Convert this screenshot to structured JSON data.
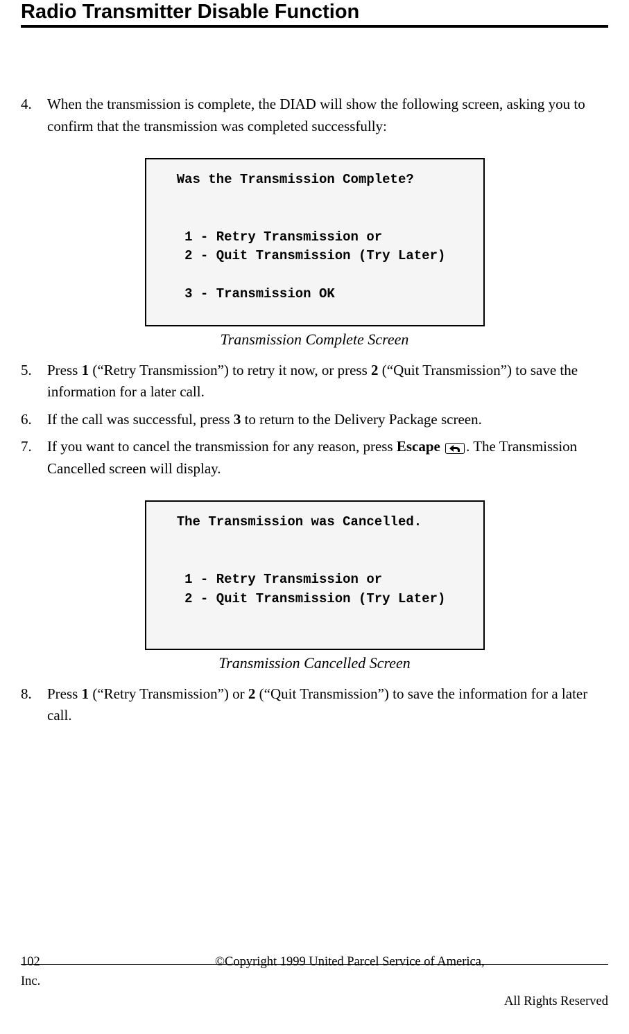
{
  "header": {
    "title": "Radio Transmitter Disable Function"
  },
  "steps": {
    "s4": {
      "num": "4.",
      "text_a": "When the transmission is complete, the DIAD will show the following screen, asking you to confirm that the transmission was completed successfully:"
    },
    "s5": {
      "num": "5.",
      "prefix": "Press ",
      "b1": "1",
      "mid1": " (“Retry Transmission”) to retry it now, or press ",
      "b2": "2",
      "mid2": " (“Quit Transmission”) to save the information for a later call."
    },
    "s6": {
      "num": "6.",
      "prefix": "If the call was successful, press ",
      "b1": "3",
      "suffix": " to return to the Delivery Package screen."
    },
    "s7": {
      "num": "7.",
      "prefix": "If you want to cancel the transmission for any reason, press ",
      "b1": "Escape",
      "suffix": ".  The Transmission Cancelled screen will display."
    },
    "s8": {
      "num": "8.",
      "prefix": "Press ",
      "b1": "1",
      "mid1": " (“Retry Transmission”) or ",
      "b2": "2",
      "mid2": " (“Quit Transmission”) to save the information for a later call."
    }
  },
  "screen1": {
    "title": "   Was the Transmission Complete?",
    "blank1": "",
    "blank2": "",
    "opt1": "    1 - Retry Transmission or",
    "opt2": "    2 - Quit Transmission (Try Later)",
    "blank3": "",
    "opt3": "    3 - Transmission OK",
    "caption": "Transmission Complete Screen"
  },
  "screen2": {
    "title": "   The Transmission was Cancelled.",
    "blank1": "",
    "blank2": "",
    "opt1": "    1 - Retry Transmission or",
    "opt2": "    2 - Quit Transmission (Try Later)",
    "blank3": "",
    "blank4": "",
    "caption": "Transmission Cancelled Screen"
  },
  "footer": {
    "page_num": "102",
    "copyright": "©Copyright 1999 United Parcel Service of America,",
    "inc": "Inc.",
    "rights": "All Rights Reserved"
  }
}
